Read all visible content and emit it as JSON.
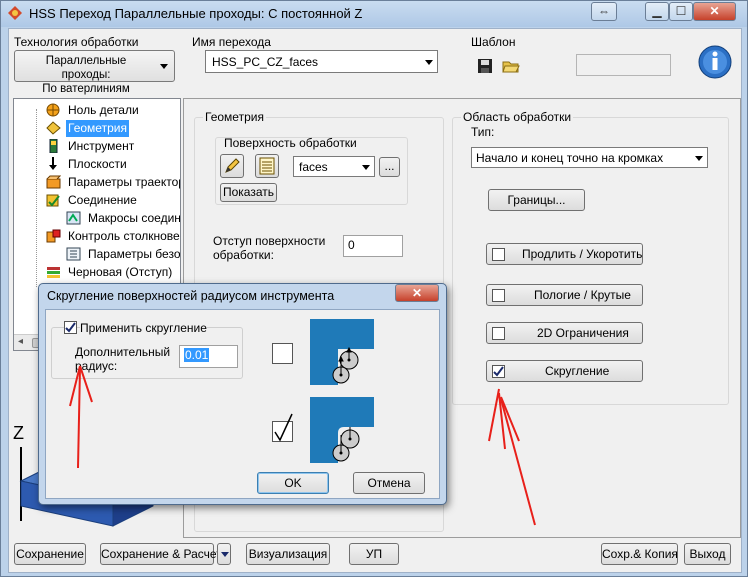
{
  "window": {
    "title": "HSS Переход Параллельные проходы: С постоянной Z"
  },
  "top": {
    "tech_label": "Технология обработки",
    "tech_value_line1": "Параллельные проходы:",
    "tech_value_line2": "По ватерлиниям",
    "name_label": "Имя перехода",
    "name_value": "HSS_PC_CZ_faces",
    "template_label": "Шаблон"
  },
  "tree": {
    "items": [
      {
        "label": "Ноль детали",
        "icon": "origin-icon"
      },
      {
        "label": "Геометрия",
        "icon": "geometry-icon"
      },
      {
        "label": "Инструмент",
        "icon": "tool-icon"
      },
      {
        "label": "Плоскости",
        "icon": "planes-icon"
      },
      {
        "label": "Параметры траектори",
        "icon": "toolpath-params-icon"
      },
      {
        "label": "Соединение",
        "icon": "link-icon"
      },
      {
        "label": "Макросы соединен",
        "icon": "macro-icon"
      },
      {
        "label": "Контроль столкновени",
        "icon": "collision-icon"
      },
      {
        "label": "Параметры безопа",
        "icon": "safety-params-icon"
      },
      {
        "label": "Черновая (Отступ)",
        "icon": "rough-icon"
      }
    ]
  },
  "geometry": {
    "title": "Геометрия",
    "surface_label": "Поверхность обработки",
    "surface_value": "faces",
    "browse_label": "...",
    "show_label": "Показать",
    "offset_label_1": "Отступ поверхности",
    "offset_label_2": "обработки:",
    "offset_value": "0"
  },
  "area": {
    "title": "Область обработки",
    "type_label": "Тип:",
    "type_value": "Начало и конец точно на кромках",
    "bounds_label": "Границы...",
    "options": [
      {
        "label": "Продлить / Укоротить",
        "checked": false
      },
      {
        "label": "Пологие / Крутые",
        "checked": false
      },
      {
        "label": "2D Ограничения",
        "checked": false
      },
      {
        "label": "Скругление",
        "checked": true
      }
    ]
  },
  "dialog": {
    "title": "Скругление поверхностей радиусом инструмента",
    "apply_label": "Применить скругление",
    "apply_checked": true,
    "radius_label_1": "Дополнительный",
    "radius_label_2": "радиус:",
    "radius_value": "0.01",
    "ok_label": "OK",
    "cancel_label": "Отмена"
  },
  "axis_label": "Z",
  "bottom": {
    "save": "Сохранение",
    "save_calc": "Сохранение & Расчет",
    "visualize": "Визуализация",
    "up": "УП",
    "save_copy": "Сохр.& Копия",
    "exit": "Выход"
  },
  "colors": {
    "accent": "#3399ff",
    "dialog_blue": "#1f7ab8",
    "annotation_red": "#e8201a"
  }
}
